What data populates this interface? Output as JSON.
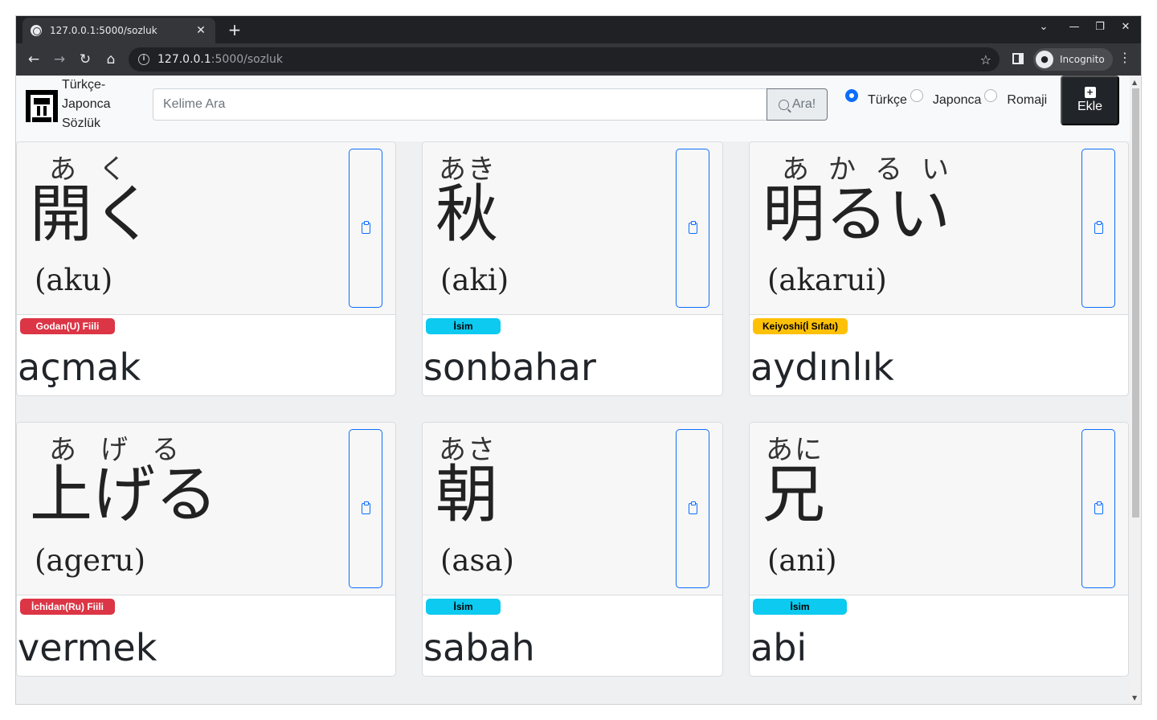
{
  "browser": {
    "tab_title": "127.0.0.1:5000/sozluk",
    "tab_close": "✕",
    "new_tab": "+",
    "url_host": "127.0.0.1",
    "url_path": ":5000/sozluk",
    "incognito_label": "Incognito",
    "controls": {
      "dropdown": "⌄",
      "minimize": "—",
      "maximize": "❐",
      "close": "✕"
    }
  },
  "app": {
    "brand": "Türkçe-Japonca Sözlük",
    "search": {
      "placeholder": "Kelime Ara",
      "button_label": "Ara!"
    },
    "languages": [
      {
        "label": "Türkçe",
        "checked": true
      },
      {
        "label": "Japonca",
        "checked": false
      },
      {
        "label": "Romaji",
        "checked": false
      }
    ],
    "add_button": {
      "label": "Ekle",
      "icon": "plus-square-icon"
    }
  },
  "cards": [
    {
      "furigana": "あく",
      "kanji": "開く",
      "romaji": "(aku)",
      "badge": "Godan(U) Fiili",
      "badge_color": "#dc3545",
      "meaning": "açmak"
    },
    {
      "furigana": "あき",
      "kanji": "秋",
      "romaji": "(aki)",
      "badge": "İsim",
      "badge_color": "#0dcaf0",
      "meaning": "sonbahar"
    },
    {
      "furigana": "あかるい",
      "kanji": "明るい",
      "romaji": "(akarui)",
      "badge": "Keiyoshi(İ Sıfatı)",
      "badge_color": "#ffc107",
      "meaning": "aydınlık"
    },
    {
      "furigana": "あげる",
      "kanji": "上げる",
      "romaji": "(ageru)",
      "badge": "İchidan(Ru) Fiili",
      "badge_color": "#dc3545",
      "meaning": "vermek"
    },
    {
      "furigana": "あさ",
      "kanji": "朝",
      "romaji": "(asa)",
      "badge": "İsim",
      "badge_color": "#0dcaf0",
      "meaning": "sabah"
    },
    {
      "furigana": "あに",
      "kanji": "兄",
      "romaji": "(ani)",
      "badge": "İsim",
      "badge_color": "#0dcaf0",
      "meaning": "abi"
    }
  ]
}
